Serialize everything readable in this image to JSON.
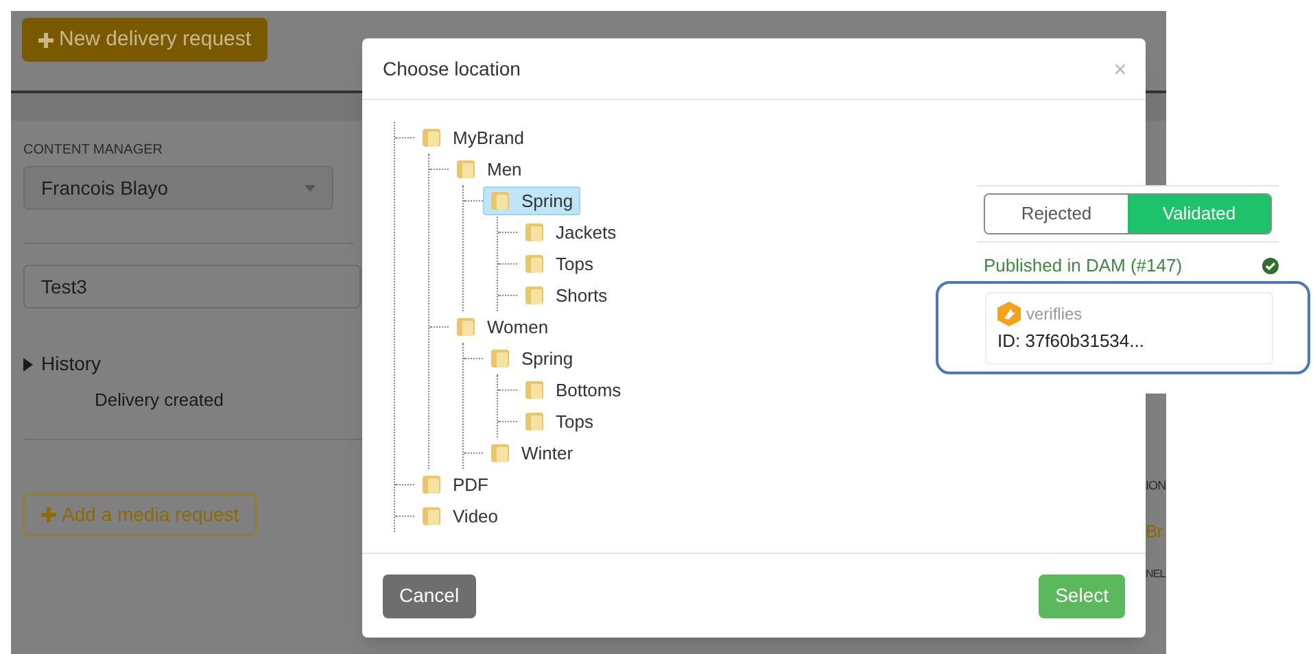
{
  "background_page": {
    "new_delivery_button": "New delivery request",
    "content_manager": {
      "label": "CONTENT MANAGER",
      "value": "Francois Blayo"
    },
    "name_field": {
      "value": "Test3"
    },
    "history": {
      "label": "History",
      "expanded": false,
      "entries": [
        "Delivery created"
      ]
    },
    "add_media_button": "Add a media request",
    "right_column_fragments": [
      "ION",
      "Br",
      "NEL"
    ]
  },
  "dialog": {
    "title": "Choose location",
    "tree": [
      {
        "label": "MyBrand",
        "selected": false,
        "children": [
          {
            "label": "Men",
            "selected": false,
            "children": [
              {
                "label": "Spring",
                "selected": true,
                "children": [
                  {
                    "label": "Jackets",
                    "selected": false
                  },
                  {
                    "label": "Tops",
                    "selected": false
                  },
                  {
                    "label": "Shorts",
                    "selected": false
                  }
                ]
              }
            ]
          },
          {
            "label": "Women",
            "selected": false,
            "children": [
              {
                "label": "Spring",
                "selected": false,
                "children": [
                  {
                    "label": "Bottoms",
                    "selected": false
                  },
                  {
                    "label": "Tops",
                    "selected": false
                  }
                ]
              },
              {
                "label": "Winter",
                "selected": false
              }
            ]
          }
        ]
      },
      {
        "label": "PDF",
        "selected": false
      },
      {
        "label": "Video",
        "selected": false
      }
    ],
    "cancel_button": "Cancel",
    "select_button": "Select"
  },
  "review_panel": {
    "toggle": [
      {
        "label": "Rejected",
        "selected": false
      },
      {
        "label": "Validated",
        "selected": true
      }
    ],
    "status": "Published in DAM (#147)",
    "card": {
      "brand": "veriflies",
      "id": "ID: 37f60b31534..."
    }
  }
}
